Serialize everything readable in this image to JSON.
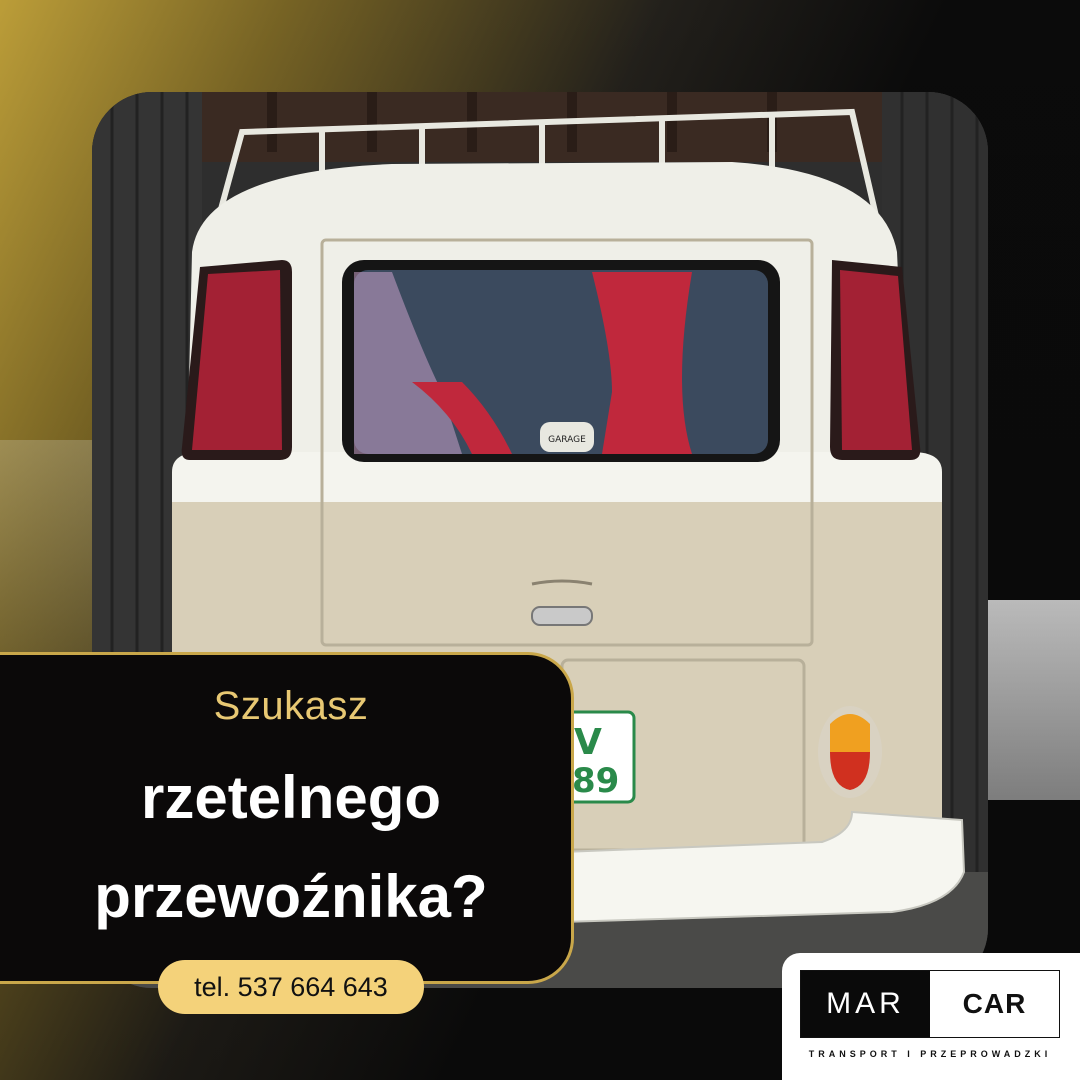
{
  "ad": {
    "kicker": "Szukasz",
    "headline_line1": "rzetelnego",
    "headline_line2": "przewoźnika?",
    "phone": "tel. 537 664 643"
  },
  "photo": {
    "badge_text": "GARAGE",
    "plate_partial_top": "V",
    "plate_partial_bottom": "89"
  },
  "logo": {
    "left": "MAR",
    "right": "CAR",
    "tagline": "TRANSPORT I PRZEPROWADZKI"
  },
  "colors": {
    "gold": "#c9a74a",
    "pill": "#f4d27a",
    "kicker": "#e8c873",
    "card": "#0b0909"
  }
}
